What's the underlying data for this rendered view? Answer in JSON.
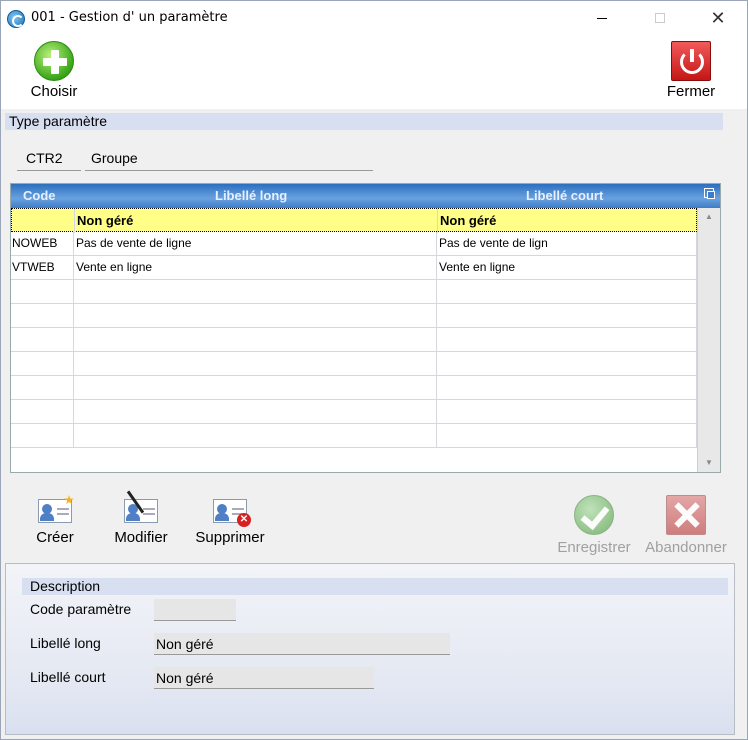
{
  "window": {
    "title": "001 - Gestion d' un paramètre"
  },
  "toolbar": {
    "choisir_label": "Choisir",
    "fermer_label": "Fermer"
  },
  "type_section": {
    "title": "Type paramètre",
    "code": "CTR2",
    "label": "Groupe"
  },
  "grid": {
    "columns": [
      "Code",
      "Libellé long",
      "Libellé court"
    ],
    "rows": [
      {
        "code": "",
        "long": "Non géré",
        "short": "Non géré",
        "selected": true
      },
      {
        "code": "NOWEB",
        "long": "Pas de vente de ligne",
        "short": "Pas de vente de lign"
      },
      {
        "code": "VTWEB",
        "long": "Vente en ligne",
        "short": "Vente en ligne"
      },
      {
        "code": "",
        "long": "",
        "short": ""
      },
      {
        "code": "",
        "long": "",
        "short": ""
      },
      {
        "code": "",
        "long": "",
        "short": ""
      },
      {
        "code": "",
        "long": "",
        "short": ""
      },
      {
        "code": "",
        "long": "",
        "short": ""
      },
      {
        "code": "",
        "long": "",
        "short": ""
      },
      {
        "code": "",
        "long": "",
        "short": ""
      }
    ]
  },
  "actions": {
    "creer": "Créer",
    "modifier": "Modifier",
    "supprimer": "Supprimer",
    "enregistrer": "Enregistrer",
    "abandonner": "Abandonner"
  },
  "description": {
    "title": "Description",
    "code_label": "Code paramètre",
    "code_value": "",
    "long_label": "Libellé long",
    "long_value": "Non géré",
    "short_label": "Libellé court",
    "short_value": "Non géré"
  },
  "colors": {
    "selected_row": "#ffff88",
    "section_bar": "#d8dff0",
    "grid_header": "#3f7cc7"
  }
}
